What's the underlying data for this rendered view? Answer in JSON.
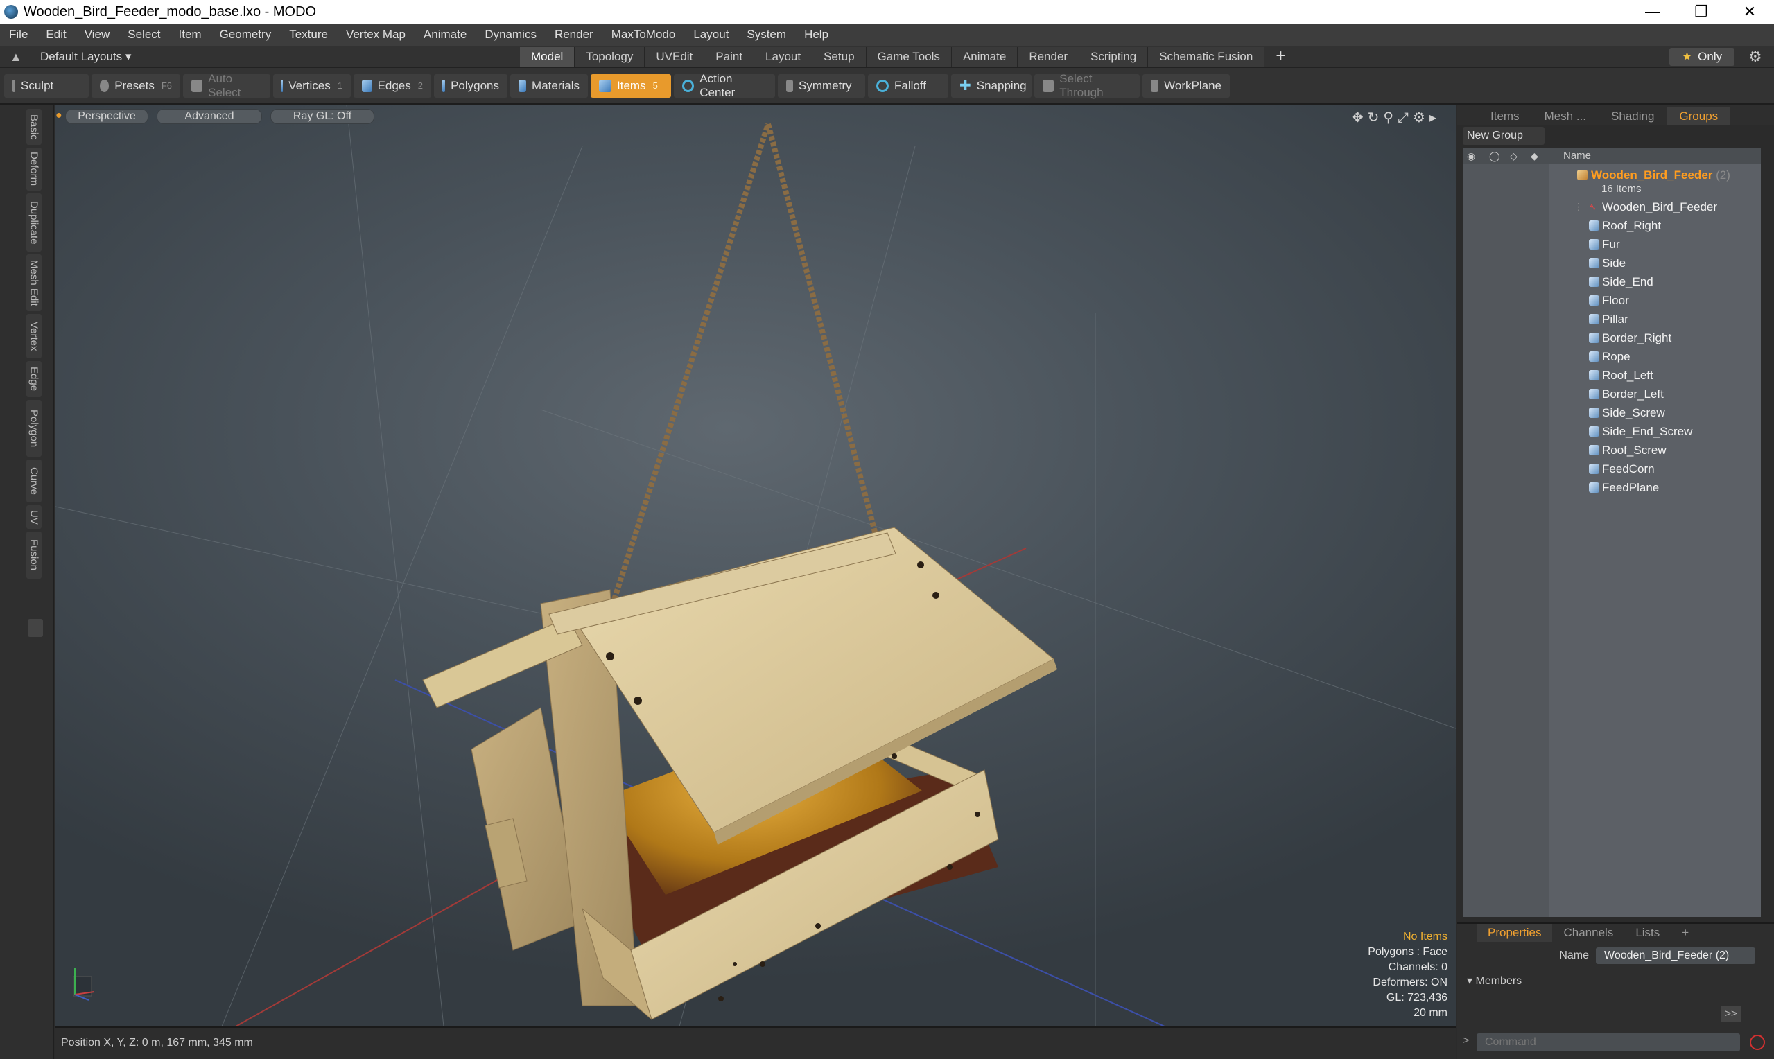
{
  "window": {
    "title": "Wooden_Bird_Feeder_modo_base.lxo - MODO",
    "controls": [
      "—",
      "❐",
      "✕"
    ]
  },
  "menu": [
    "File",
    "Edit",
    "View",
    "Select",
    "Item",
    "Geometry",
    "Texture",
    "Vertex Map",
    "Animate",
    "Dynamics",
    "Render",
    "MaxToModo",
    "Layout",
    "System",
    "Help"
  ],
  "layoutbar": {
    "layouts": "Default Layouts ▾",
    "tabs": [
      "Model",
      "Topology",
      "UVEdit",
      "Paint",
      "Layout",
      "Setup",
      "Game Tools",
      "Animate",
      "Render",
      "Scripting",
      "Schematic Fusion"
    ],
    "active_tab": "Model",
    "plus": "+",
    "only": "Only"
  },
  "toolbar": {
    "sculpt": "Sculpt",
    "presets": "Presets",
    "presets_key": "F6",
    "auto_select": "Auto Select",
    "vertices": "Vertices",
    "vertices_key": "1",
    "edges": "Edges",
    "edges_key": "2",
    "polygons": "Polygons",
    "materials": "Materials",
    "items": "Items",
    "items_key": "5",
    "action_center": "Action Center",
    "symmetry": "Symmetry",
    "falloff": "Falloff",
    "snapping": "Snapping",
    "select_through": "Select Through",
    "workplane": "WorkPlane"
  },
  "left_tabs": [
    "Basic",
    "Deform",
    "Duplicate",
    "Mesh Edit",
    "Vertex",
    "Edge",
    "Polygon",
    "Curve",
    "UV",
    "Fusion"
  ],
  "viewport": {
    "perspective": "Perspective",
    "advanced": "Advanced",
    "raygl": "Ray GL: Off",
    "status": {
      "items": "No Items",
      "polygons": "Polygons : Face",
      "channels": "Channels: 0",
      "deformers": "Deformers: ON",
      "gl": "GL: 723,436",
      "scale": "20 mm"
    }
  },
  "statusbar": {
    "position": "Position X, Y, Z:   0 m, 167 mm, 345 mm"
  },
  "right_panel": {
    "tabs": [
      "Items",
      "Mesh ...",
      "Shading",
      "Groups"
    ],
    "active_tab": "Groups",
    "new_group": "New Group",
    "column_name": "Name",
    "group": {
      "name": "Wooden_Bird_Feeder",
      "count": "(2)",
      "items_label": "16 Items"
    },
    "items": [
      "Wooden_Bird_Feeder",
      "Roof_Right",
      "Fur",
      "Side",
      "Side_End",
      "Floor",
      "Pillar",
      "Border_Right",
      "Rope",
      "Roof_Left",
      "Border_Left",
      "Side_Screw",
      "Side_End_Screw",
      "Roof_Screw",
      "FeedCorn",
      "FeedPlane"
    ],
    "props_tabs": [
      "Properties",
      "Channels",
      "Lists",
      "+"
    ],
    "props_active": "Properties",
    "name_label": "Name",
    "name_value": "Wooden_Bird_Feeder (2)",
    "members": "Members",
    "more": ">>",
    "command_placeholder": "Command"
  }
}
